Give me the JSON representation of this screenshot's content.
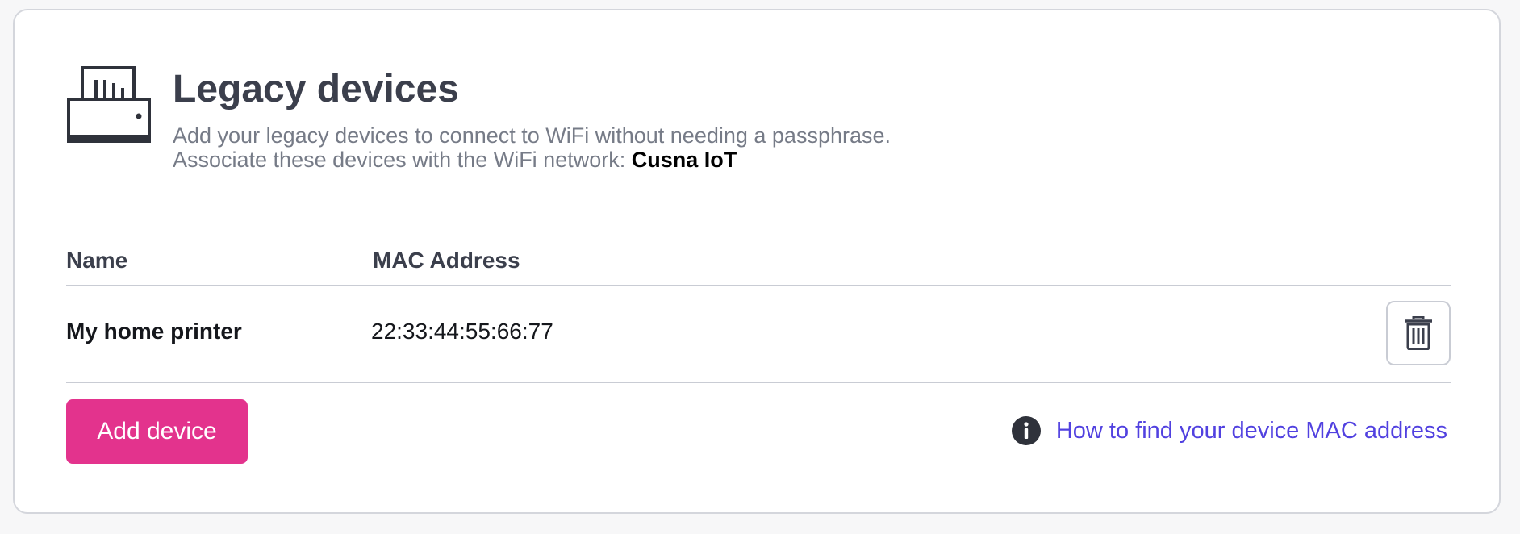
{
  "header": {
    "icon": "printer-icon",
    "title": "Legacy devices",
    "subtitle_line1": "Add your legacy devices to connect to WiFi without needing a passphrase.",
    "subtitle_line2_prefix": "Associate these devices with the WiFi network:",
    "network_name": "Cusna IoT"
  },
  "table": {
    "columns": [
      "Name",
      "MAC Address"
    ],
    "rows": [
      {
        "name": "My home printer",
        "mac": "22:33:44:55:66:77",
        "action_icon": "trash-icon"
      }
    ]
  },
  "footer": {
    "add_button_label": "Add device",
    "help_icon": "info-icon",
    "help_link_label": "How to find your device MAC address"
  },
  "colors": {
    "accent": "#e3338d",
    "link": "#5141e0",
    "title": "#3b3f4c",
    "subtitle": "#767b87",
    "border": "#d4d6dc"
  }
}
